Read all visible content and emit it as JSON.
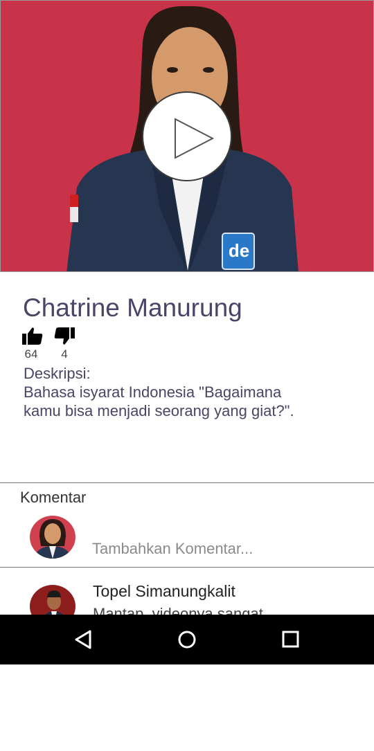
{
  "video": {
    "badge_text": "de",
    "colors": {
      "background": "#c8334a",
      "jacket": "#263550"
    }
  },
  "profile": {
    "name": "Chatrine Manurung",
    "likes": "64",
    "dislikes": "4",
    "description_label": "Deskripsi:",
    "description": "Bahasa isyarat Indonesia \"Bagaimana kamu bisa menjadi seorang yang giat?\"."
  },
  "comments": {
    "title": "Komentar",
    "input_placeholder": "Tambahkan Komentar...",
    "items": [
      {
        "author": "Topel Simanungkalit",
        "text": "Mantap, videonya sangat"
      }
    ]
  },
  "icons": {
    "play": "play-icon",
    "like": "thumbs-up-icon",
    "dislike": "thumbs-down-icon",
    "back": "back-triangle-icon",
    "home": "home-circle-icon",
    "recents": "recents-square-icon"
  }
}
